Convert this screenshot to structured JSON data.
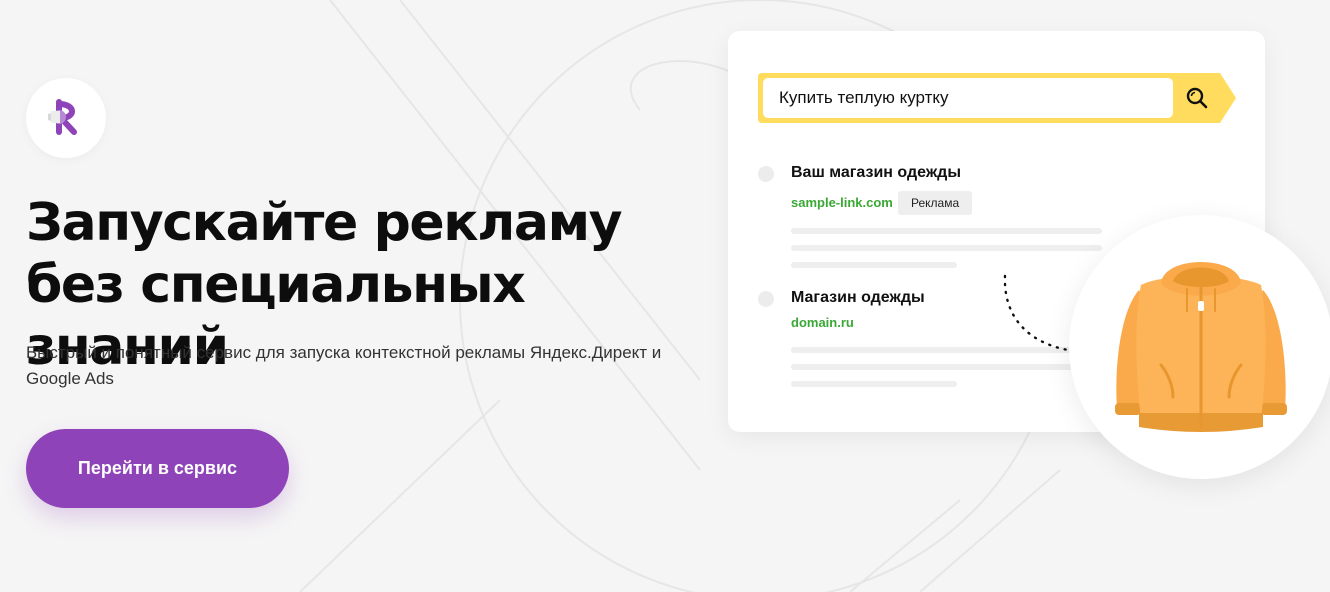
{
  "brand": {
    "logo_icon": "megaphone-r-logo-icon",
    "accent": "#8e44b8"
  },
  "hero": {
    "headline": "Запускайте рекламу без специальных знаний",
    "subtitle": "Быстрый и понятный сервис для запуска контекстной рекламы Яндекс.Директ и Google Ads",
    "cta_label": "Перейти в сервис"
  },
  "preview": {
    "search": {
      "value": "Купить теплую куртку",
      "icon": "search-icon",
      "border_color": "#ffdc5e"
    },
    "results": [
      {
        "title": "Ваш магазин одежды",
        "link": "sample-link.com",
        "badge": "Реклама"
      },
      {
        "title": "Магазин одежды",
        "link": "domain.ru"
      }
    ],
    "product_icon": "jacket-icon",
    "link_color": "#3aa835"
  }
}
